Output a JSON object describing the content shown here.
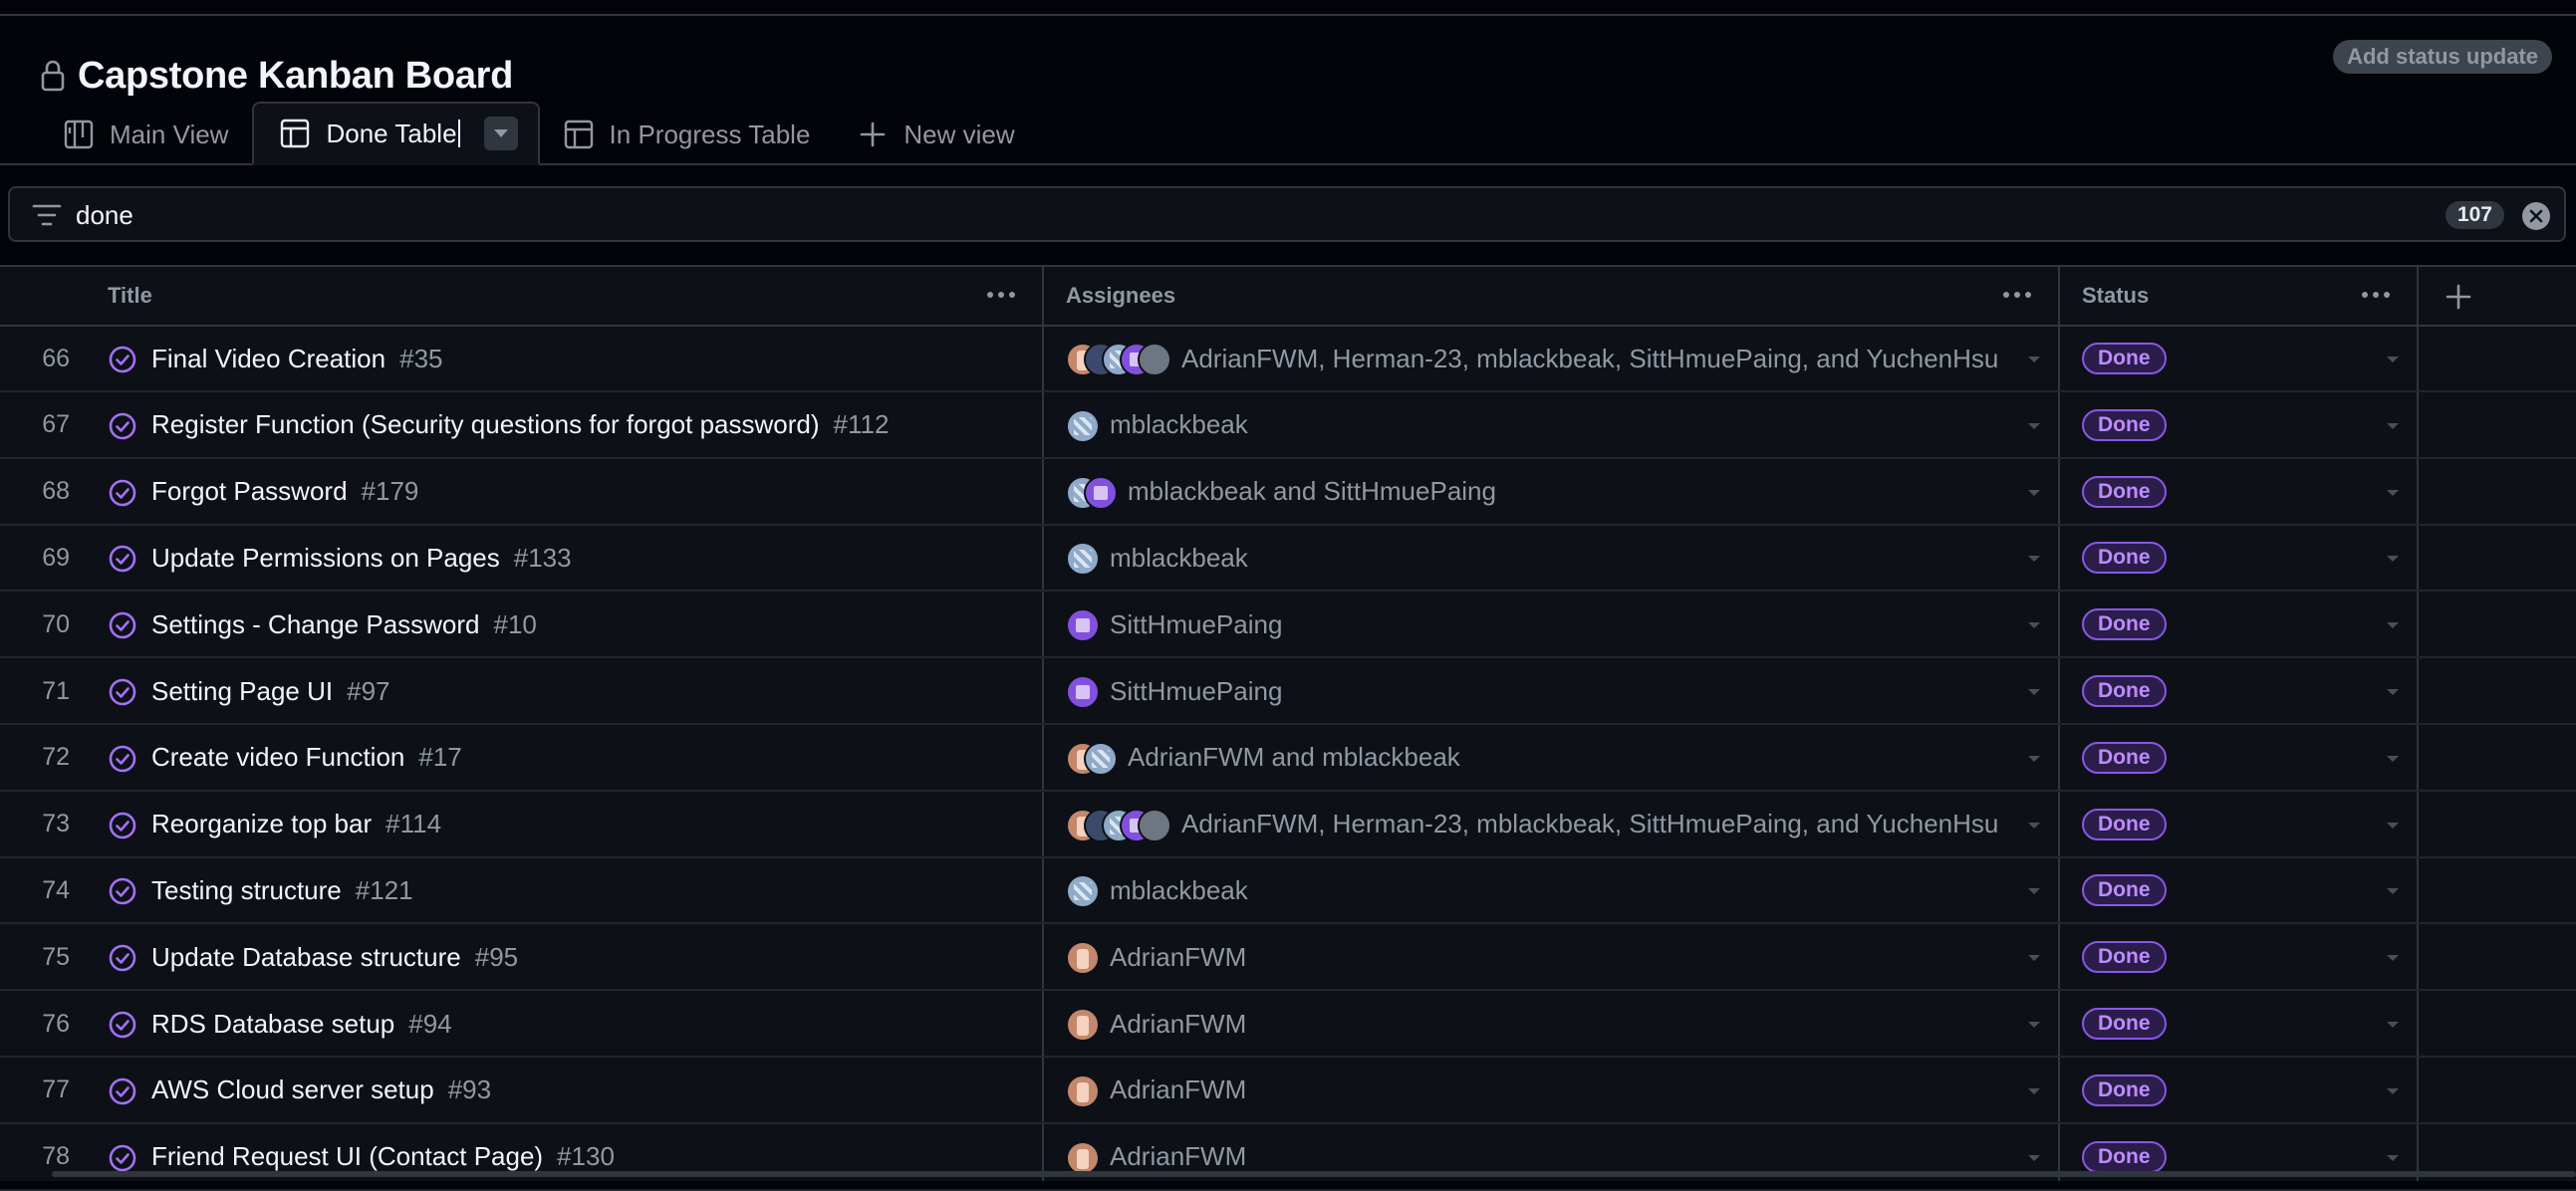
{
  "project": {
    "title": "Capstone Kanban Board",
    "status_update_label": "Add status update"
  },
  "tabs": [
    {
      "label": "Main View",
      "icon": "board-icon",
      "active": false
    },
    {
      "label": "Done Table",
      "icon": "table-icon",
      "active": true
    },
    {
      "label": "In Progress Table",
      "icon": "table-icon",
      "active": false
    },
    {
      "label": "New view",
      "icon": "plus-icon",
      "active": false
    }
  ],
  "filter": {
    "value": "done",
    "count": "107"
  },
  "columns": {
    "title": "Title",
    "assignees": "Assignees",
    "status": "Status"
  },
  "rows": [
    {
      "num": "66",
      "title": "Final Video Creation",
      "issue": "#35",
      "assignees": "AdrianFWM, Herman-23, mblackbeak, SittHmuePaing, and YuchenHsu",
      "status": "Done"
    },
    {
      "num": "67",
      "title": "Register Function (Security questions for forgot password)",
      "issue": "#112",
      "assignees": "mblackbeak",
      "status": "Done"
    },
    {
      "num": "68",
      "title": "Forgot Password",
      "issue": "#179",
      "assignees": "mblackbeak and SittHmuePaing",
      "status": "Done"
    },
    {
      "num": "69",
      "title": "Update Permissions on Pages",
      "issue": "#133",
      "assignees": "mblackbeak",
      "status": "Done"
    },
    {
      "num": "70",
      "title": "Settings - Change Password",
      "issue": "#10",
      "assignees": "SittHmuePaing",
      "status": "Done"
    },
    {
      "num": "71",
      "title": "Setting Page UI",
      "issue": "#97",
      "assignees": "SittHmuePaing",
      "status": "Done"
    },
    {
      "num": "72",
      "title": "Create video Function",
      "issue": "#17",
      "assignees": "AdrianFWM and mblackbeak",
      "status": "Done"
    },
    {
      "num": "73",
      "title": "Reorganize top bar",
      "issue": "#114",
      "assignees": "AdrianFWM, Herman-23, mblackbeak, SittHmuePaing, and YuchenHsu",
      "status": "Done"
    },
    {
      "num": "74",
      "title": "Testing structure",
      "issue": "#121",
      "assignees": "mblackbeak",
      "status": "Done"
    },
    {
      "num": "75",
      "title": "Update Database structure",
      "issue": "#95",
      "assignees": "AdrianFWM",
      "status": "Done"
    },
    {
      "num": "76",
      "title": "RDS Database setup",
      "issue": "#94",
      "assignees": "AdrianFWM",
      "status": "Done"
    },
    {
      "num": "77",
      "title": "AWS Cloud server setup",
      "issue": "#93",
      "assignees": "AdrianFWM",
      "status": "Done"
    },
    {
      "num": "78",
      "title": "Friend Request UI (Contact Page)",
      "issue": "#130",
      "assignees": "AdrianFWM",
      "status": "Done"
    }
  ],
  "colors": {
    "background": "#010409",
    "surface": "#0d1117",
    "border": "#30363d",
    "done_purple": "#8957e5",
    "text": "#e6edf3",
    "muted": "#9198a1"
  }
}
